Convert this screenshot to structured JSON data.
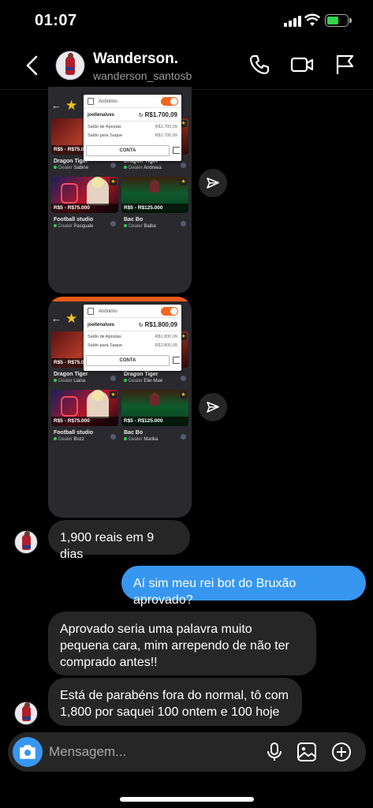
{
  "status_bar": {
    "time": "01:07",
    "battery_color": "#32d74b"
  },
  "header": {
    "name": "Wanderson.",
    "username": "wanderson_santosb",
    "icons": [
      "back-arrow-icon",
      "phone-icon",
      "video-camera-icon",
      "flag-icon"
    ]
  },
  "shared_screenshots": [
    {
      "popup": {
        "anon_label": "Anônimo",
        "user": "joellenalves",
        "balance": "R$1.700,09",
        "bet_label": "Saldo de Apostas",
        "bet_value": "R$1.700,09",
        "withdraw_label": "Saldo para Saque",
        "withdraw_value": "R$1.700,09",
        "button": "CONTA"
      },
      "games": [
        {
          "price": "R$5 - R$75.000",
          "title": "Dragon Tiger",
          "dealer_prefix": "Dealer",
          "dealer": "Sabine"
        },
        {
          "price": "",
          "title": "Dragon Tiger",
          "dealer_prefix": "Dealer",
          "dealer": "Andreea"
        },
        {
          "price": "R$5 - R$75.000",
          "title": "Football studio",
          "dealer_prefix": "Dealer",
          "dealer": "Pasquale"
        },
        {
          "price": "R$5 - R$125.000",
          "title": "Bac Bo",
          "dealer_prefix": "Dealer",
          "dealer": "Baiba"
        }
      ]
    },
    {
      "popup": {
        "anon_label": "Anônimo",
        "user": "joellenalves",
        "balance": "R$1.800,09",
        "bet_label": "Saldo de Apostas",
        "bet_value": "R$1.800,09",
        "withdraw_label": "Saldo para Saque",
        "withdraw_value": "R$1.800,09",
        "button": "CONTA"
      },
      "games": [
        {
          "price": "R$5 - R$75.000",
          "title": "Dragon Tiger",
          "dealer_prefix": "Dealer",
          "dealer": "Liana"
        },
        {
          "price": "",
          "title": "Dragon Tiger",
          "dealer_prefix": "Dealer",
          "dealer": "Elle-Mae"
        },
        {
          "price": "R$5 - R$75.000",
          "title": "Football studio",
          "dealer_prefix": "Dealer",
          "dealer": "Bozz"
        },
        {
          "price": "R$5 - R$125.000",
          "title": "Bac Bo",
          "dealer_prefix": "Dealer",
          "dealer": "Marika"
        }
      ]
    }
  ],
  "messages": [
    {
      "from": "them",
      "text": "1,900 reais em 9 dias"
    },
    {
      "from": "me",
      "text": "Aí sim meu rei bot do Bruxão aprovado?"
    },
    {
      "from": "them",
      "text": "Aprovado seria uma palavra muito pequena cara, mim arrependo de não ter comprado antes!!"
    },
    {
      "from": "them",
      "text": "Está de parabéns fora do normal, tô com 1,800 por saquei 100 ontem e 100 hoje"
    }
  ],
  "composer": {
    "placeholder": "Mensagem...",
    "icons": [
      "camera-icon",
      "microphone-icon",
      "gallery-icon",
      "add-icon"
    ],
    "accent": "#3797f0"
  }
}
